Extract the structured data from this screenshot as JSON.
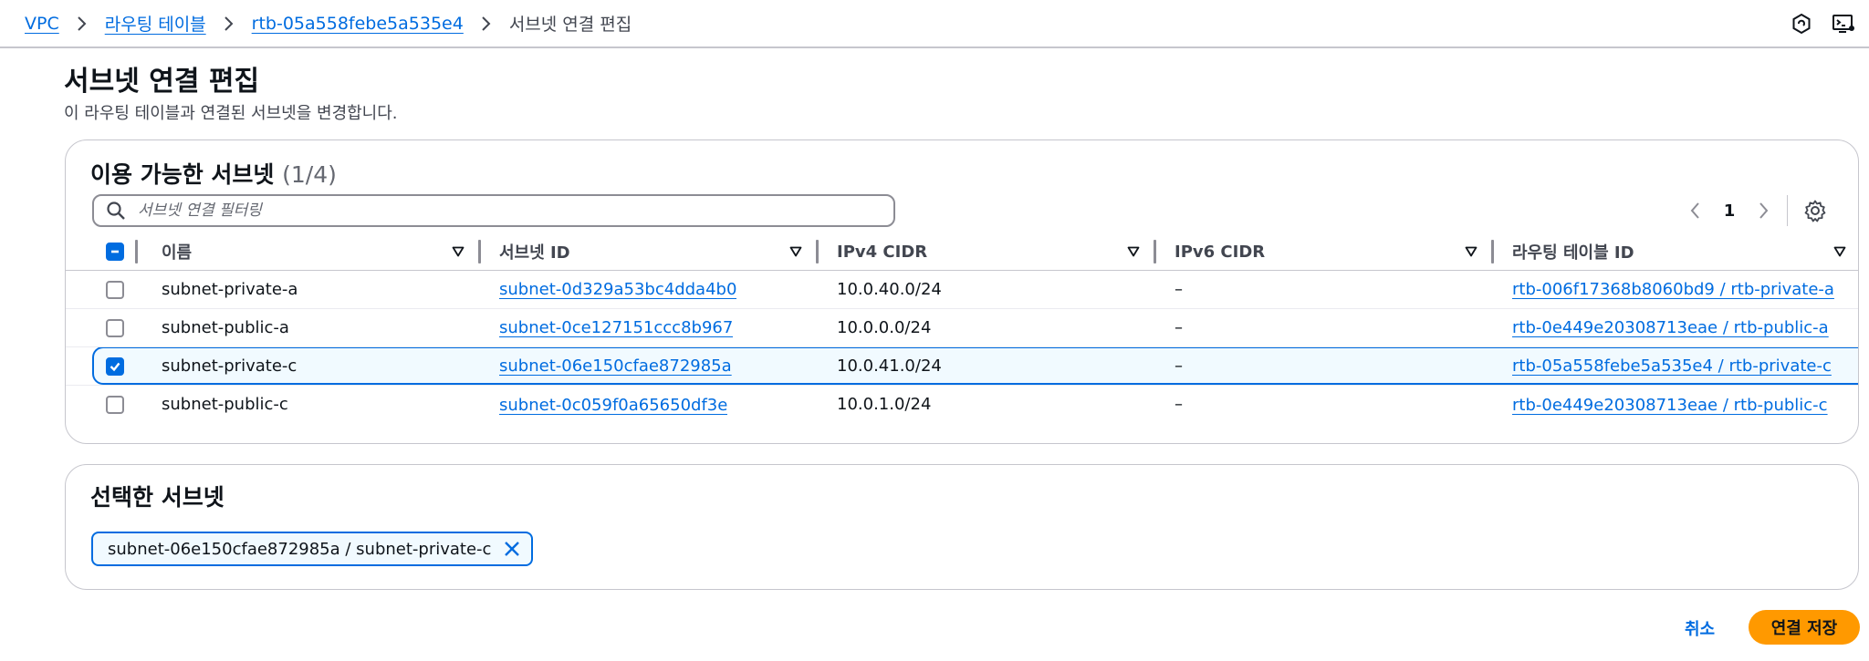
{
  "breadcrumb": {
    "items": [
      "VPC",
      "라우팅 테이블",
      "rtb-05a558febe5a535e4"
    ],
    "current": "서브넷 연결 편집"
  },
  "header_icons": [
    "feedback-icon",
    "cloudshell-icon"
  ],
  "page": {
    "title": "서브넷 연결 편집",
    "description": "이 라우팅 테이블과 연결된 서브넷을 변경합니다."
  },
  "available": {
    "title": "이용 가능한 서브넷",
    "count": "(1/4)",
    "filter_placeholder": "서브넷 연결 필터링",
    "page_number": "1",
    "columns": [
      "이름",
      "서브넷 ID",
      "IPv4 CIDR",
      "IPv6 CIDR",
      "라우팅 테이블 ID"
    ],
    "rows": [
      {
        "checked": false,
        "name": "subnet-private-a",
        "subnet_id": "subnet-0d329a53bc4dda4b0",
        "ipv4": "10.0.40.0/24",
        "ipv6": "–",
        "route_table": "rtb-006f17368b8060bd9 / rtb-private-a"
      },
      {
        "checked": false,
        "name": "subnet-public-a",
        "subnet_id": "subnet-0ce127151ccc8b967",
        "ipv4": "10.0.0.0/24",
        "ipv6": "–",
        "route_table": "rtb-0e449e20308713eae / rtb-public-a"
      },
      {
        "checked": true,
        "name": "subnet-private-c",
        "subnet_id": "subnet-06e150cfae872985a",
        "ipv4": "10.0.41.0/24",
        "ipv6": "–",
        "route_table": "rtb-05a558febe5a535e4 / rtb-private-c"
      },
      {
        "checked": false,
        "name": "subnet-public-c",
        "subnet_id": "subnet-0c059f0a65650df3e",
        "ipv4": "10.0.1.0/24",
        "ipv6": "–",
        "route_table": "rtb-0e449e20308713eae / rtb-public-c"
      }
    ]
  },
  "selected": {
    "title": "선택한 서브넷",
    "token": "subnet-06e150cfae872985a / subnet-private-c"
  },
  "actions": {
    "cancel": "취소",
    "save": "연결 저장"
  },
  "colors": {
    "link": "#006ce0",
    "primary_button": "#ff9900",
    "selected_row_bg": "#f1faff"
  }
}
